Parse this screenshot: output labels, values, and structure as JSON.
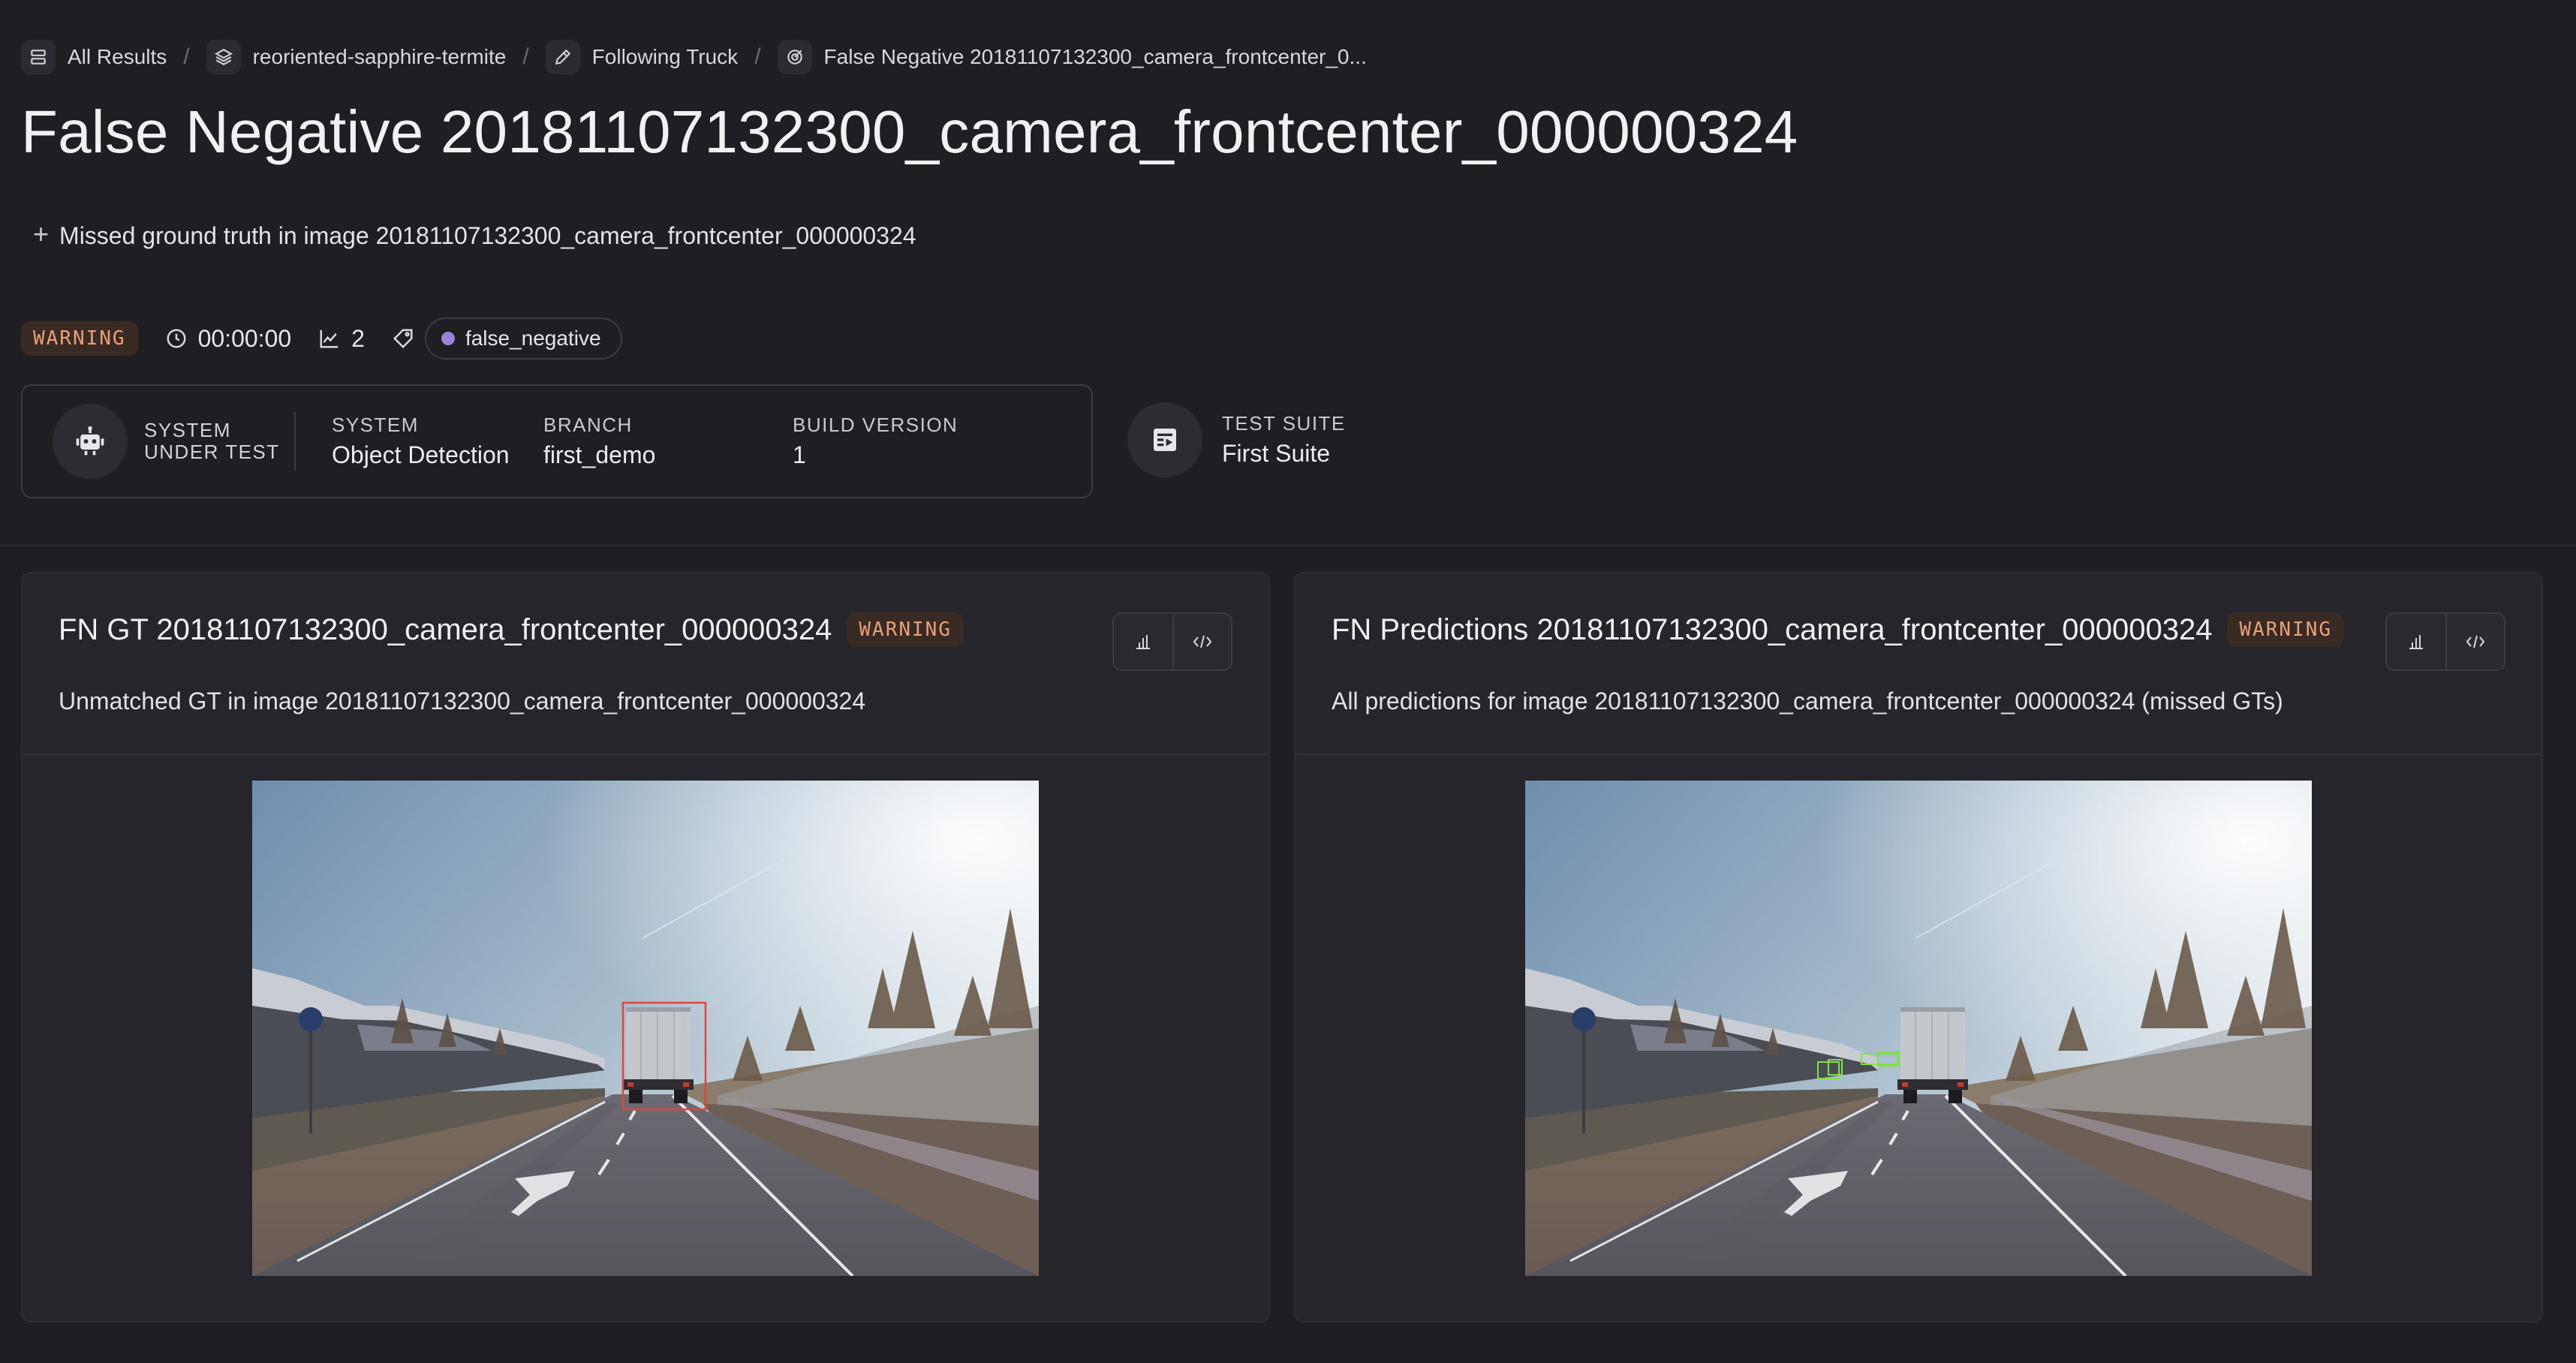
{
  "breadcrumb": [
    {
      "label": "All Results",
      "icon": "list-icon"
    },
    {
      "label": "reoriented-sapphire-termite",
      "icon": "layers-icon"
    },
    {
      "label": "Following Truck",
      "icon": "pencil-icon"
    },
    {
      "label": "False Negative 20181107132300_camera_frontcenter_0...",
      "icon": "target-icon"
    }
  ],
  "breadcrumb_separator": "/",
  "page": {
    "title": "False Negative 20181107132300_camera_frontcenter_000000324",
    "description": "Missed ground truth in image 20181107132300_camera_frontcenter_000000324",
    "add_symbol": "+"
  },
  "status": {
    "badge": "WARNING",
    "duration": "00:00:00",
    "metric_count": "2",
    "tag": "false_negative"
  },
  "system": {
    "sut_label_line1": "SYSTEM",
    "sut_label_line2": "UNDER TEST",
    "system_key": "SYSTEM",
    "system_value": "Object Detection",
    "branch_key": "BRANCH",
    "branch_value": "first_demo",
    "build_key": "BUILD VERSION",
    "build_value": "1",
    "suite_key": "TEST SUITE",
    "suite_value": "First Suite"
  },
  "panels": [
    {
      "title": "FN GT 20181107132300_camera_frontcenter_000000324",
      "badge": "WARNING",
      "description": "Unmatched GT in image 20181107132300_camera_frontcenter_000000324"
    },
    {
      "title": "FN Predictions 20181107132300_camera_frontcenter_000000324",
      "badge": "WARNING",
      "description": "All predictions for image 20181107132300_camera_frontcenter_000000324 (missed GTs)"
    }
  ],
  "colors": {
    "background": "#1e1e23",
    "panel": "#25252b",
    "warning_text": "#e8a07a",
    "warning_bg": "#3a2a24",
    "tag_dot": "#9a82d8",
    "gt_box": "#e0463a",
    "prediction_box": "#7fe04a"
  }
}
